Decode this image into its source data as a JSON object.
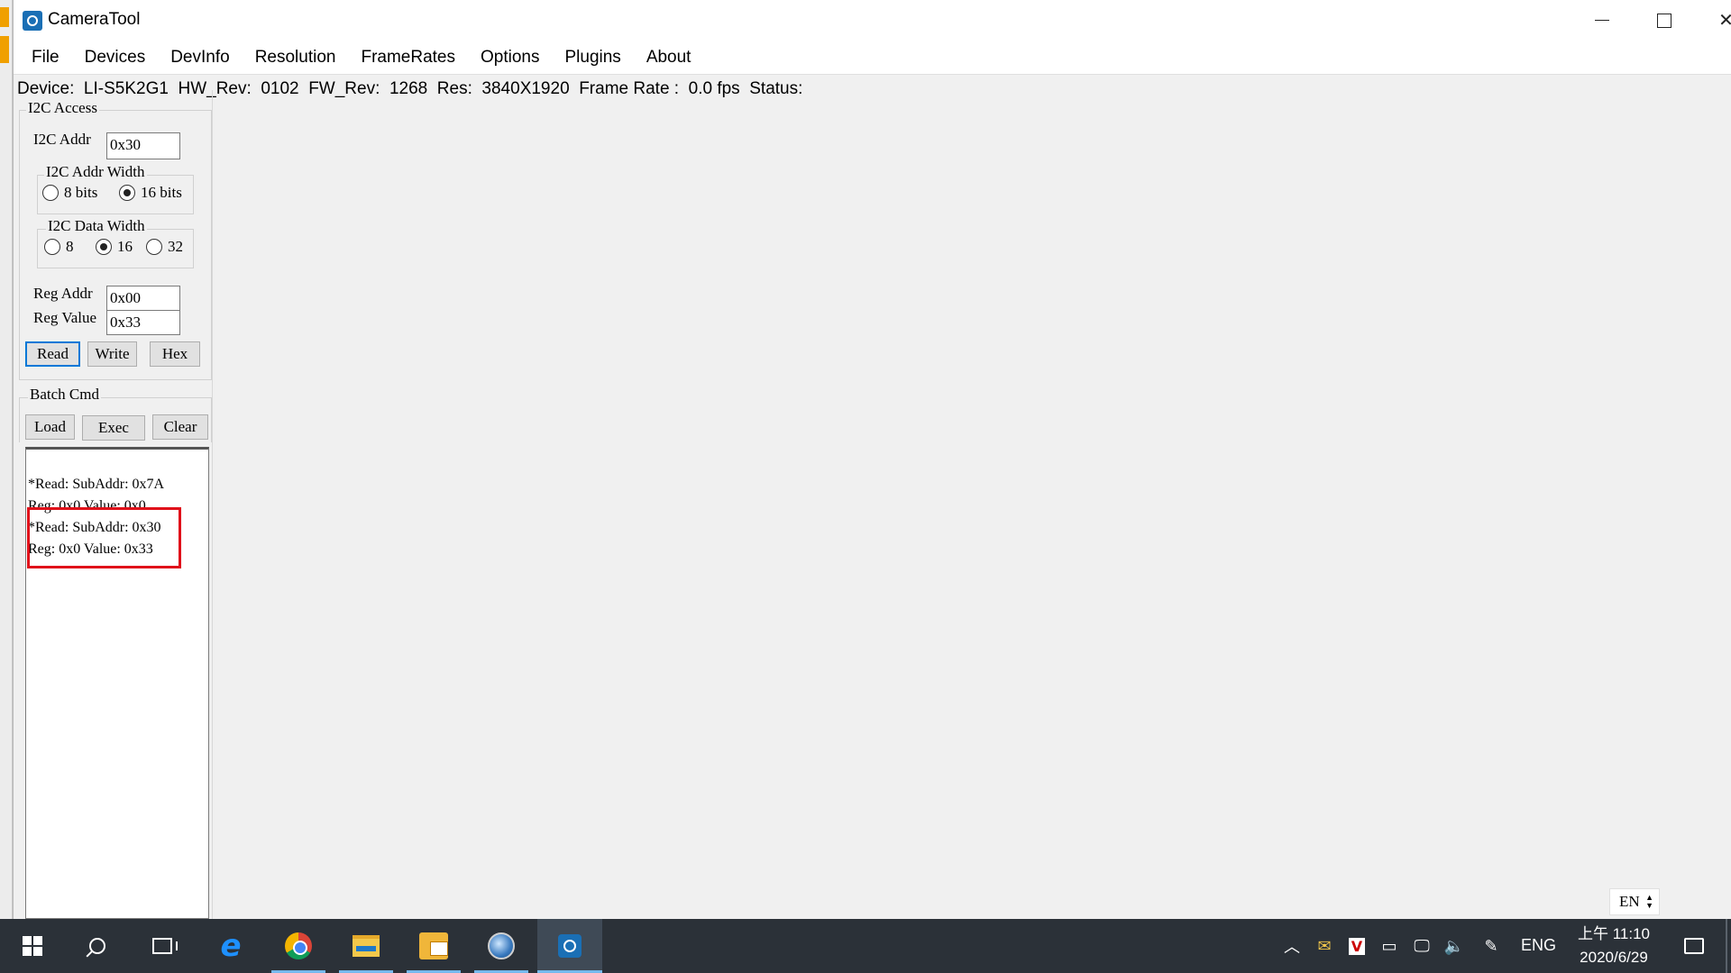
{
  "window": {
    "title": "CameraTool"
  },
  "menu": [
    "File",
    "Devices",
    "DevInfo",
    "Resolution",
    "FrameRates",
    "Options",
    "Plugins",
    "About"
  ],
  "infobar": {
    "device_label": "Device:",
    "device_value": "LI-S5K2G1",
    "hwrev_label": "HW_Rev:",
    "hwrev_value": "0102",
    "fwrev_label": "FW_Rev:",
    "fwrev_value": "1268",
    "res_label": "Res:",
    "res_value": "3840X1920",
    "framerate_label": "Frame Rate :",
    "framerate_value": "0.0 fps",
    "status_label": "Status:"
  },
  "i2c": {
    "group_title": "I2C Access",
    "addr_label": "I2C Addr",
    "addr_value": "0x30",
    "addr_width_title": "I2C Addr Width",
    "addr_width_options": [
      "8 bits",
      "16 bits"
    ],
    "addr_width_selected": "16 bits",
    "data_width_title": "I2C Data Width",
    "data_width_options": [
      "8",
      "16",
      "32"
    ],
    "data_width_selected": "16",
    "reg_addr_label": "Reg Addr",
    "reg_addr_value": "0x00",
    "reg_value_label": "Reg Value",
    "reg_value_value": "0x33",
    "read_label": "Read",
    "write_label": "Write",
    "hex_label": "Hex"
  },
  "batch": {
    "group_title": "Batch Cmd",
    "load_label": "Load",
    "exec_label": "Exec",
    "clear_label": "Clear",
    "log": [
      "*Read: SubAddr: 0x7A",
      "Reg: 0x0 Value: 0x0",
      "*Read: SubAddr: 0x30",
      "Reg: 0x0 Value: 0x33"
    ]
  },
  "lang_widget": "EN",
  "taskbar": {
    "tray_lang": "ENG",
    "clock_time": "上午 11:10",
    "clock_date": "2020/6/29"
  },
  "colors": {
    "highlight_box": "#e0101a",
    "focus_border": "#0078d7",
    "taskbar": "#2b3138"
  }
}
